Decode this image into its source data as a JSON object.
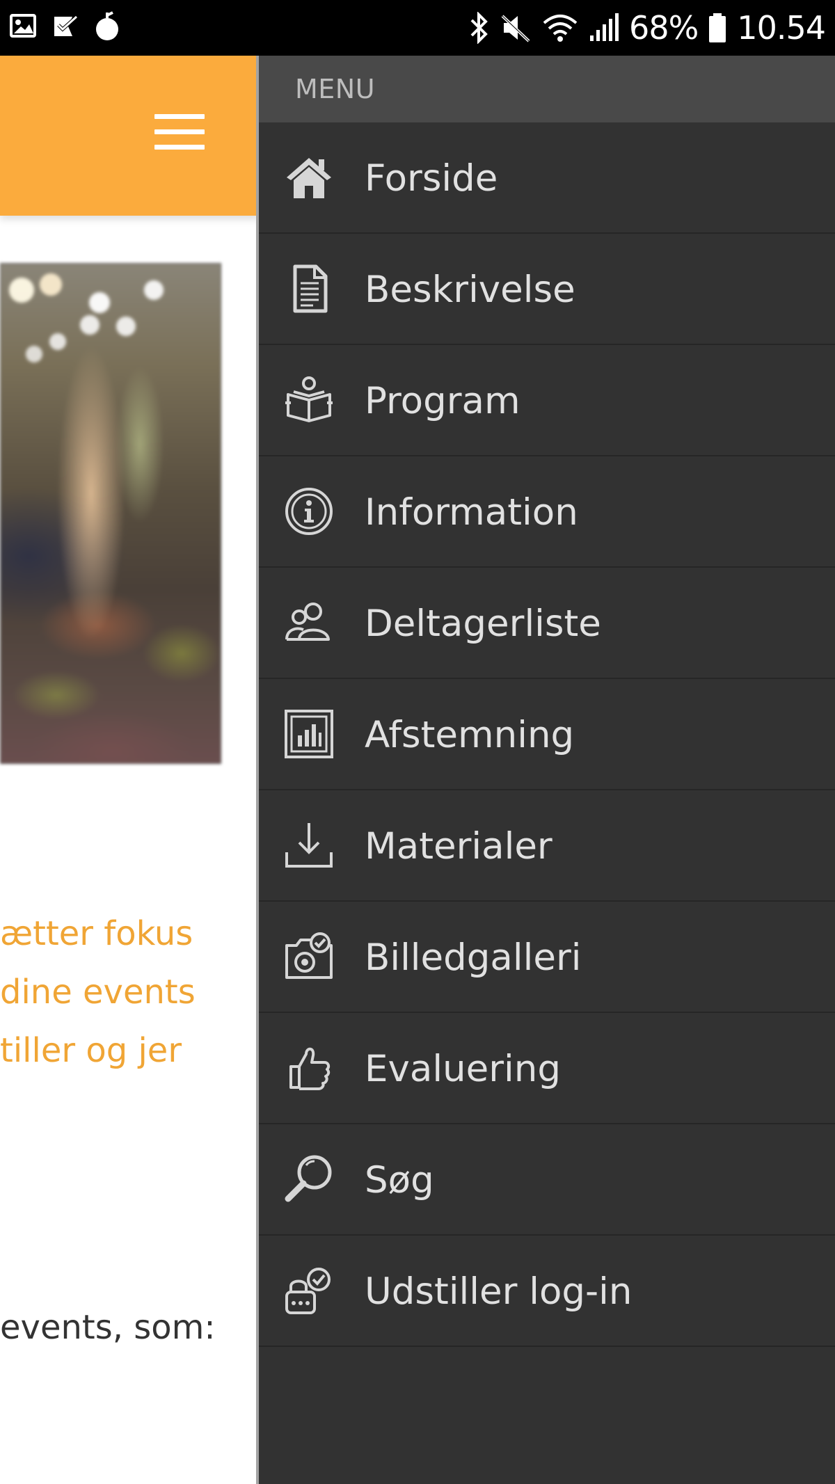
{
  "status_bar": {
    "battery_percent": "68%",
    "time": "10.54",
    "left_icons": [
      "gallery-notification-icon",
      "task-notification-icon",
      "app-notification-icon"
    ],
    "right_icons": [
      "bluetooth-icon",
      "mute-icon",
      "wifi-icon",
      "signal-icon",
      "battery-icon"
    ]
  },
  "header": {
    "color": "#fbab3d",
    "menu_icon": "hamburger-menu-icon"
  },
  "page": {
    "orange_lines": [
      "ætter fokus",
      "dine events",
      "tiller og jer"
    ],
    "orange_color": "#f0a535",
    "body_line": "events, som:"
  },
  "drawer": {
    "title": "MENU",
    "background": "#323232",
    "items": [
      {
        "label": "Forside",
        "icon": "home-icon"
      },
      {
        "label": "Beskrivelse",
        "icon": "document-icon"
      },
      {
        "label": "Program",
        "icon": "open-book-icon"
      },
      {
        "label": "Information",
        "icon": "info-icon"
      },
      {
        "label": "Deltagerliste",
        "icon": "people-icon"
      },
      {
        "label": "Afstemning",
        "icon": "bar-chart-icon"
      },
      {
        "label": "Materialer",
        "icon": "download-icon"
      },
      {
        "label": "Billedgalleri",
        "icon": "camera-icon"
      },
      {
        "label": "Evaluering",
        "icon": "thumbs-up-icon"
      },
      {
        "label": "Søg",
        "icon": "search-icon"
      },
      {
        "label": "Udstiller log-in",
        "icon": "exhibitor-login-icon"
      }
    ]
  }
}
